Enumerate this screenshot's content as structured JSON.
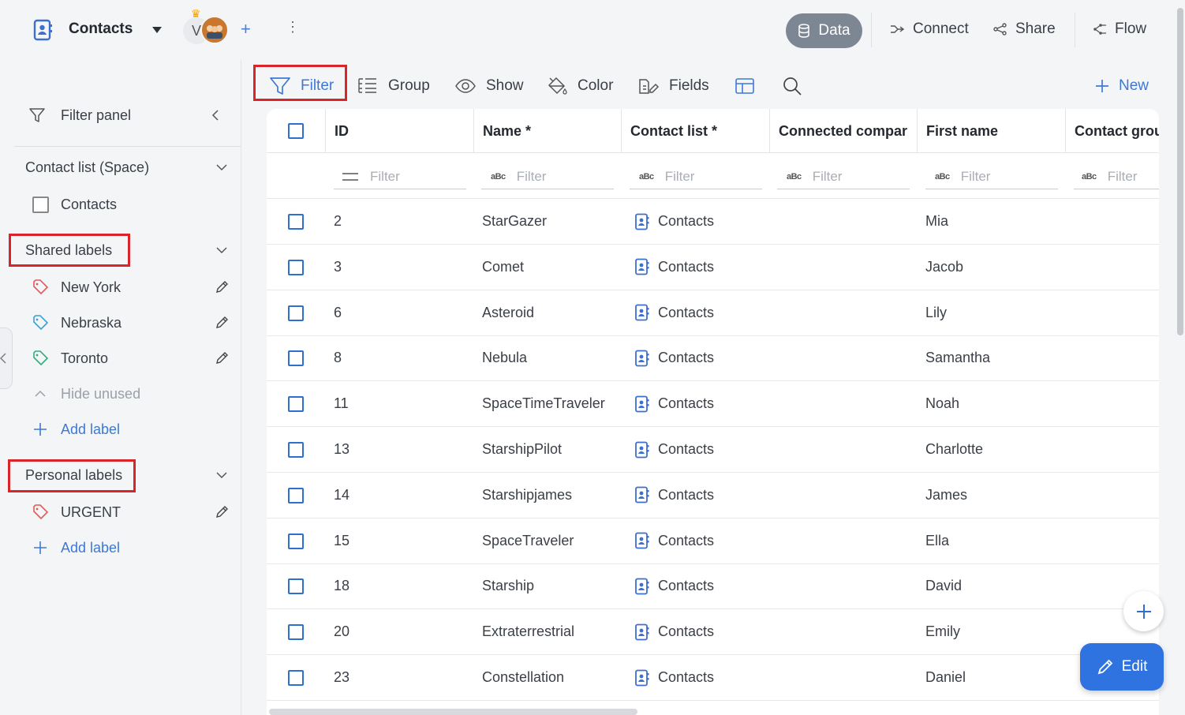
{
  "header": {
    "app_title": "Contacts",
    "avatar_initial": "V",
    "nav": {
      "data": "Data",
      "connect": "Connect",
      "share": "Share",
      "flow": "Flow"
    }
  },
  "toolbar": {
    "filter": "Filter",
    "group": "Group",
    "show": "Show",
    "color": "Color",
    "fields": "Fields",
    "new": "New"
  },
  "sidebar": {
    "filter_panel": "Filter panel",
    "contact_list_section": "Contact list (Space)",
    "contact_list_item": "Contacts",
    "shared_labels_title": "Shared labels",
    "shared_labels": [
      {
        "label": "New York",
        "color": "#e05a5a"
      },
      {
        "label": "Nebraska",
        "color": "#3aa0d8"
      },
      {
        "label": "Toronto",
        "color": "#2fae7a"
      }
    ],
    "hide_unused": "Hide unused",
    "add_label": "Add label",
    "personal_labels_title": "Personal labels",
    "personal_labels": [
      {
        "label": "URGENT",
        "color": "#e05a5a"
      }
    ]
  },
  "table": {
    "columns": [
      "ID",
      "Name *",
      "Contact list *",
      "Connected compar",
      "First name",
      "Contact grou"
    ],
    "filter_placeholder": "Filter",
    "rows": [
      {
        "id": "2",
        "name": "StarGazer",
        "list": "Contacts",
        "first": "Mia"
      },
      {
        "id": "3",
        "name": "Comet",
        "list": "Contacts",
        "first": "Jacob"
      },
      {
        "id": "6",
        "name": "Asteroid",
        "list": "Contacts",
        "first": "Lily"
      },
      {
        "id": "8",
        "name": "Nebula",
        "list": "Contacts",
        "first": "Samantha"
      },
      {
        "id": "11",
        "name": "SpaceTimeTraveler",
        "list": "Contacts",
        "first": "Noah"
      },
      {
        "id": "13",
        "name": "StarshipPilot",
        "list": "Contacts",
        "first": "Charlotte"
      },
      {
        "id": "14",
        "name": "Starshipjames",
        "list": "Contacts",
        "first": "James"
      },
      {
        "id": "15",
        "name": "SpaceTraveler",
        "list": "Contacts",
        "first": "Ella"
      },
      {
        "id": "18",
        "name": "Starship",
        "list": "Contacts",
        "first": "David"
      },
      {
        "id": "20",
        "name": "Extraterrestrial",
        "list": "Contacts",
        "first": "Emily"
      },
      {
        "id": "23",
        "name": "Constellation",
        "list": "Contacts",
        "first": "Daniel"
      }
    ]
  },
  "actions": {
    "edit": "Edit"
  },
  "colors": {
    "accent": "#2f73e0",
    "highlight_box": "#d9242a"
  }
}
